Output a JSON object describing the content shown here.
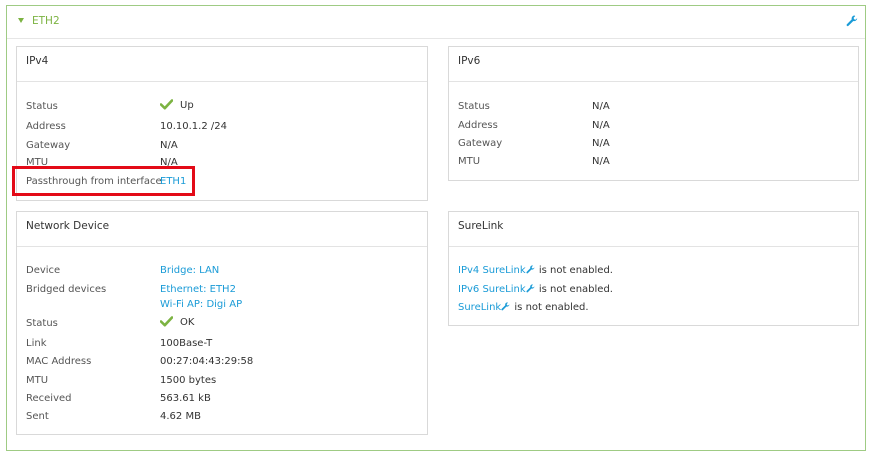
{
  "header": {
    "title": "ETH2"
  },
  "ipv4": {
    "title": "IPv4",
    "rows": [
      {
        "label": "Status",
        "value": "Up"
      },
      {
        "label": "Address",
        "value": "10.10.1.2 /24"
      },
      {
        "label": "Gateway",
        "value": "N/A"
      },
      {
        "label": "MTU",
        "value": "N/A"
      },
      {
        "label": "Passthrough from interface",
        "value": "ETH1"
      }
    ]
  },
  "ipv6": {
    "title": "IPv6",
    "rows": [
      {
        "label": "Status",
        "value": "N/A"
      },
      {
        "label": "Address",
        "value": "N/A"
      },
      {
        "label": "Gateway",
        "value": "N/A"
      },
      {
        "label": "MTU",
        "value": "N/A"
      }
    ]
  },
  "network_device": {
    "title": "Network Device",
    "device": {
      "label": "Device",
      "value": "Bridge: LAN"
    },
    "bridged": {
      "label": "Bridged devices",
      "values": [
        "Ethernet: ETH2",
        "Wi-Fi AP: Digi AP"
      ]
    },
    "status": {
      "label": "Status",
      "value": "OK"
    },
    "link": {
      "label": "Link",
      "value": "100Base-T"
    },
    "mac": {
      "label": "MAC Address",
      "value": "00:27:04:43:29:58"
    },
    "mtu": {
      "label": "MTU",
      "value": "1500 bytes"
    },
    "received": {
      "label": "Received",
      "value": "563.61 kB"
    },
    "sent": {
      "label": "Sent",
      "value": "4.62 MB"
    }
  },
  "surelink": {
    "title": "SureLink",
    "lines": [
      {
        "link": "IPv4 SureLink",
        "text": " is not enabled."
      },
      {
        "link": "IPv6 SureLink",
        "text": " is not enabled."
      },
      {
        "link": "SureLink",
        "text": " is not enabled."
      }
    ]
  },
  "icons": {
    "collapse": "triangle-down-icon",
    "settings": "wrench-icon",
    "status_ok": "checkmark-icon"
  },
  "colors": {
    "accent_green": "#7cb342",
    "link_blue": "#1a9bd7",
    "highlight_red": "#e30a17"
  }
}
